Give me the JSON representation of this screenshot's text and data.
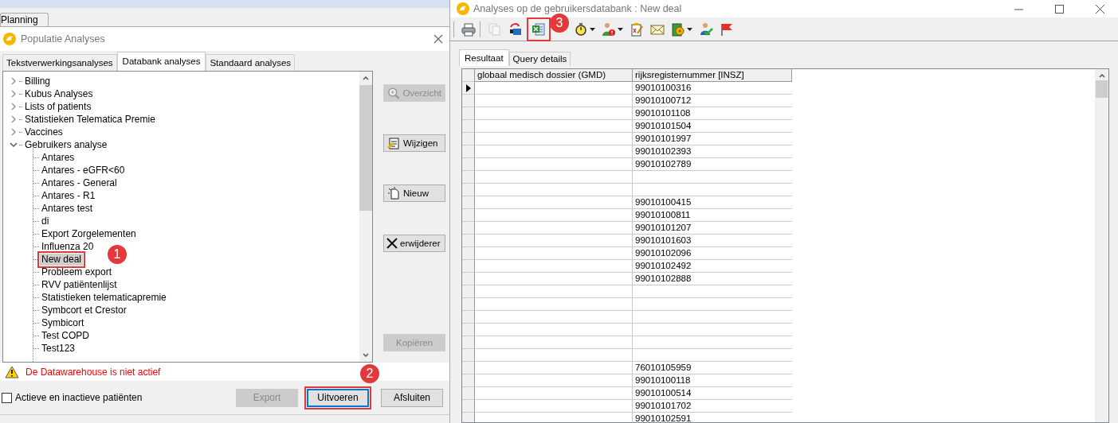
{
  "planning_tab": {
    "label": "Planning"
  },
  "dialog": {
    "title": "Populatie Analyses",
    "tabs": [
      {
        "label": "Tekstverwerkingsanalyses",
        "selected": false
      },
      {
        "label": "Databank analyses",
        "selected": true
      },
      {
        "label": "Standaard analyses",
        "selected": false
      }
    ],
    "tree": [
      {
        "label": "Billing",
        "expanded": false
      },
      {
        "label": "Kubus Analyses",
        "expanded": false
      },
      {
        "label": "Lists of patients",
        "expanded": false
      },
      {
        "label": "Statistieken Telematica Premie",
        "expanded": false
      },
      {
        "label": "Vaccines",
        "expanded": false
      },
      {
        "label": "Gebruikers analyse",
        "expanded": true,
        "children": [
          {
            "label": "Antares",
            "selected": false
          },
          {
            "label": "Antares - eGFR<60",
            "selected": false
          },
          {
            "label": "Antares - General",
            "selected": false
          },
          {
            "label": "Antares - R1",
            "selected": false
          },
          {
            "label": "Antares test",
            "selected": false
          },
          {
            "label": "di",
            "selected": false
          },
          {
            "label": "Export Zorgelementen",
            "selected": false
          },
          {
            "label": "Influenza 20",
            "selected": false
          },
          {
            "label": "New deal",
            "selected": true,
            "highlighted": true,
            "badge": "1"
          },
          {
            "label": "Probleem export",
            "selected": false
          },
          {
            "label": "RVV patiëntenlijst",
            "selected": false
          },
          {
            "label": "Statistieken telematicapremie",
            "selected": false
          },
          {
            "label": "Symbcort et Crestor",
            "selected": false
          },
          {
            "label": "Symbicort",
            "selected": false
          },
          {
            "label": "Test COPD",
            "selected": false
          },
          {
            "label": "Test123",
            "selected": false
          }
        ]
      }
    ],
    "side_buttons": [
      {
        "label": "Overzicht",
        "disabled": true
      },
      {
        "label": "Wijzigen",
        "disabled": false
      },
      {
        "label": "Nieuw",
        "disabled": false
      },
      {
        "label": "erwijderer",
        "disabled": false
      },
      {
        "label": "Kopiëren",
        "disabled": true
      }
    ],
    "warning": "De Datawarehouse is niet actief",
    "checkbox": {
      "label": "Actieve en inactieve patiënten",
      "checked": false
    },
    "buttons": [
      {
        "label": "Export",
        "disabled": true,
        "focused": false
      },
      {
        "label": "Uitvoeren",
        "disabled": false,
        "focused": true,
        "highlighted": true,
        "badge": "2"
      },
      {
        "label": "Afsluiten",
        "disabled": false,
        "focused": false
      }
    ]
  },
  "results": {
    "title": "Analyses op de gebruikersdatabank : New deal",
    "toolbar": [
      {
        "disabled": false,
        "dropdown": false
      },
      {
        "disabled": true,
        "dropdown": false
      },
      {
        "disabled": false,
        "dropdown": false
      },
      {
        "disabled": false,
        "dropdown": false,
        "highlighted": true,
        "badge": "3"
      },
      {
        "disabled": false,
        "dropdown": true
      },
      {
        "disabled": false,
        "dropdown": true
      },
      {
        "disabled": false,
        "dropdown": false
      },
      {
        "disabled": false,
        "dropdown": false
      },
      {
        "disabled": false,
        "dropdown": true
      },
      {
        "disabled": false,
        "dropdown": false
      },
      {
        "disabled": false,
        "dropdown": false
      }
    ],
    "tabs": [
      {
        "label": "Resultaat",
        "selected": true
      },
      {
        "label": "Query details",
        "selected": false
      }
    ],
    "columns": [
      "globaal medisch dossier (GMD)",
      "rijksregisternummer [INSZ]"
    ],
    "rows": [
      {
        "insz": "99010100316",
        "current": true
      },
      {
        "insz": "99010100712",
        "current": false
      },
      {
        "insz": "99010101108",
        "current": false
      },
      {
        "insz": "99010101504",
        "current": false
      },
      {
        "insz": "99010101997",
        "current": false
      },
      {
        "insz": "99010102393",
        "current": false
      },
      {
        "insz": "99010102789",
        "current": false
      },
      {
        "current": false
      },
      {
        "current": false
      },
      {
        "insz": "99010100415",
        "current": false
      },
      {
        "insz": "99010100811",
        "current": false
      },
      {
        "insz": "99010101207",
        "current": false
      },
      {
        "insz": "99010101603",
        "current": false
      },
      {
        "insz": "99010102096",
        "current": false
      },
      {
        "insz": "99010102492",
        "current": false
      },
      {
        "insz": "99010102888",
        "current": false
      },
      {
        "current": false
      },
      {
        "current": false
      },
      {
        "current": false
      },
      {
        "current": false
      },
      {
        "current": false
      },
      {
        "current": false
      },
      {
        "insz": "76010105959",
        "current": false
      },
      {
        "insz": "99010100118",
        "current": false
      },
      {
        "insz": "99010100514",
        "current": false
      },
      {
        "insz": "99010101702",
        "current": false
      },
      {
        "insz": "99010102591",
        "current": false
      }
    ]
  }
}
